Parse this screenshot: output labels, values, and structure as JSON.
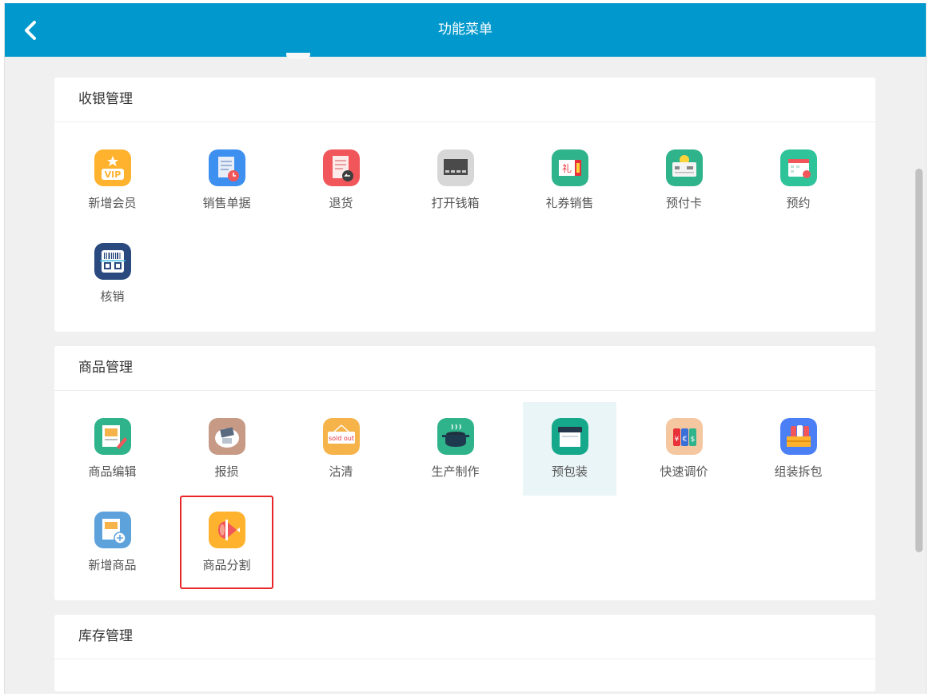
{
  "header": {
    "title": "功能菜单",
    "back_icon": "chevron-left-icon"
  },
  "sections": [
    {
      "title": "收银管理",
      "items": [
        {
          "label": "新增会员",
          "icon": "vip-crown-icon",
          "color": "#ffb22e"
        },
        {
          "label": "销售单据",
          "icon": "receipt-clock-icon",
          "color": "#3d8ff0"
        },
        {
          "label": "退货",
          "icon": "return-receipt-icon",
          "color": "#f0565a"
        },
        {
          "label": "打开钱箱",
          "icon": "cash-drawer-icon",
          "color": "#d0d0d0"
        },
        {
          "label": "礼券销售",
          "icon": "gift-ticket-icon",
          "color": "#2fb38a"
        },
        {
          "label": "预付卡",
          "icon": "prepaid-card-icon",
          "color": "#2fb38a"
        },
        {
          "label": "预约",
          "icon": "calendar-icon",
          "color": "#2fc39a"
        },
        {
          "label": "核销",
          "icon": "barcode-icon",
          "color": "#2a4a7f"
        }
      ]
    },
    {
      "title": "商品管理",
      "items": [
        {
          "label": "商品编辑",
          "icon": "product-edit-icon",
          "color": "#2fb38a"
        },
        {
          "label": "报损",
          "icon": "damage-report-icon",
          "color": "#c79a86"
        },
        {
          "label": "沽清",
          "icon": "sold-out-icon",
          "color": "#f5b34a",
          "sign_text": "sold out"
        },
        {
          "label": "生产制作",
          "icon": "cooking-pot-icon",
          "color": "#2fb38a"
        },
        {
          "label": "预包装",
          "icon": "prepack-icon",
          "color": "#16a88a",
          "active": true
        },
        {
          "label": "快速调价",
          "icon": "price-tags-icon",
          "color": "#f5c7a0",
          "tag_texts": [
            "¥",
            "€",
            "$"
          ]
        },
        {
          "label": "组装拆包",
          "icon": "bundle-box-icon",
          "color": "#4a7ff5"
        },
        {
          "label": "新增商品",
          "icon": "add-product-icon",
          "color": "#5ea2dc"
        },
        {
          "label": "商品分割",
          "icon": "meat-split-icon",
          "color": "#ffb22e",
          "selected": true
        }
      ]
    },
    {
      "title": "库存管理",
      "items": []
    }
  ]
}
